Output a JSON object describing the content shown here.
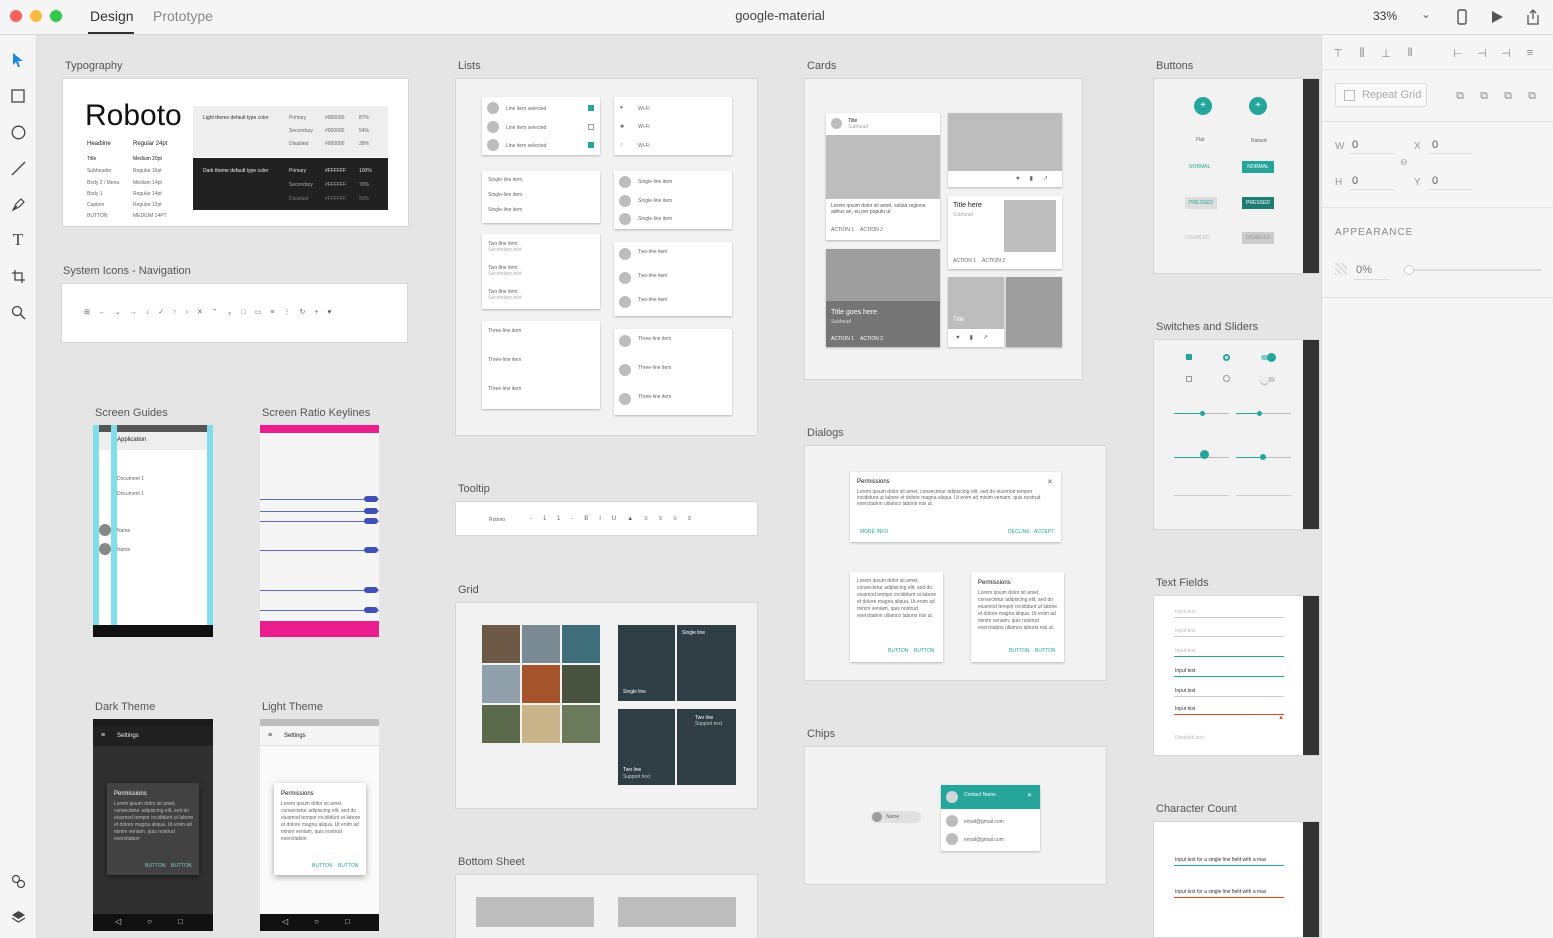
{
  "titlebar": {
    "tabs": [
      "Design",
      "Prototype"
    ],
    "doc_title": "google-material",
    "zoom": "33%"
  },
  "tools": [
    "select-tool",
    "rectangle-tool",
    "ellipse-tool",
    "line-tool",
    "pen-tool",
    "text-tool",
    "artboard-tool",
    "zoom-tool"
  ],
  "artboards": {
    "typography": "Typography",
    "system_icons": "System Icons - Navigation",
    "screen_guides": "Screen Guides",
    "screen_ratio": "Screen Ratio Keylines",
    "dark_theme": "Dark Theme",
    "light_theme": "Light Theme",
    "lists": "Lists",
    "tooltip": "Tooltip",
    "grid": "Grid",
    "bottom_sheet": "Bottom Sheet",
    "cards": "Cards",
    "dialogs": "Dialogs",
    "chips": "Chips",
    "buttons": "Buttons",
    "switches": "Switches and Sliders",
    "text_fields": "Text Fields",
    "character_count": "Character Count"
  },
  "typography": {
    "roboto": "Roboto",
    "rows": [
      [
        "Headline",
        "Regular 24pt"
      ],
      [
        "Title",
        "Medium 20pt"
      ],
      [
        "Subheader",
        "Regular 16pt"
      ],
      [
        "Body 2 / Menu",
        "Medium 14pt"
      ],
      [
        "Body 1",
        "Regular 14pt"
      ],
      [
        "Caption",
        "Regular 12pt"
      ],
      [
        "BUTTON",
        "MEDIUM 14PT"
      ]
    ],
    "light_label": "Light theme default type color",
    "dark_label": "Dark theme default type color",
    "light_rows": [
      [
        "Primary",
        "#000000",
        "87%"
      ],
      [
        "Secondary",
        "#000000",
        "54%"
      ],
      [
        "Disabled",
        "#000000",
        "38%"
      ]
    ],
    "dark_rows": [
      [
        "Primary",
        "#FFFFFF",
        "100%"
      ],
      [
        "Secondary",
        "#FFFFFF",
        "70%"
      ],
      [
        "Disabled",
        "#FFFFFF",
        "50%"
      ]
    ]
  },
  "guides": {
    "app_title": "Application",
    "items": [
      "Document 1",
      "Document 1",
      "Name",
      "Name"
    ]
  },
  "dark_theme": {
    "bar": "Settings",
    "dialog_title": "Permissions",
    "dialog_text": "Lorem ipsum dolor sit amet, consectetur adipiscing elit, sed do eiusmod tempor incididunt ut labore et dolore magna aliqua. Ut enim ad minim veniam, quis nostrud exercitation",
    "btn1": "BUTTON",
    "btn2": "BUTTON"
  },
  "light_theme": {
    "bar": "Settings",
    "dialog_title": "Permissions",
    "dialog_text": "Lorem ipsum dolor sit amet, consectetur adipiscing elit, sed do eiusmod tempor incididunt ut labore et dolore magna aliqua. Ut enim ad minim veniam, quis nostrud exercitation",
    "btn1": "BUTTON",
    "btn2": "BUTTON"
  },
  "lists": {
    "selected": [
      "Line item selected",
      "Line item selected",
      "Line item selected"
    ],
    "wifi": [
      "Wi-Fi",
      "Wi-Fi",
      "Wi-Fi"
    ],
    "single": [
      "Single-line item",
      "Single-line item",
      "Single-line item"
    ],
    "two": "Two-line item",
    "two_sub": "Secondary text",
    "three": "Three-line item"
  },
  "tooltip": {
    "font": "Roboto"
  },
  "grid": {
    "single": "Single line",
    "two": "Two line",
    "support": "Support text"
  },
  "cards": {
    "title": "Title",
    "subtitle": "Subhead",
    "text": "Lorem ipsum dolor sit amet, soluta regione adhuc an, eu per populo ut",
    "action1": "ACTION 1",
    "action2": "ACTION 2",
    "title_here": "Title here",
    "title_goes_here": "Title goes here",
    "title_small": "Title"
  },
  "dialogs": {
    "title": "Permissions",
    "text": "Lorem ipsum dolor sit amet, consectetur adipiscing elit, sed do eiusmod tempor incididunt ut labore et dolore magna aliqua. Ut enim ad minim veniam, quis nostrud exercitation ullamco laboris nisi ut.",
    "more": "MORE INFO",
    "decline": "DECLINE",
    "accept": "ACCEPT",
    "button": "BUTTON"
  },
  "chips": {
    "chip_label": "Name",
    "contact_name": "Contact Name",
    "emails": [
      "email@gmail.com",
      "email@gmail.com"
    ]
  },
  "buttons": {
    "flat": "Flat",
    "raised": "Raised",
    "normal": "NORMAL",
    "pressed": "PRESSED",
    "disabled": "DISABLED"
  },
  "text_fields": {
    "labels": [
      "Input text",
      "Input text",
      "Input text",
      "Input text",
      "Input text",
      "Input text",
      "Disabled text"
    ]
  },
  "char_count": {
    "input": "Input text for a single line field with a max"
  },
  "panel": {
    "repeat_grid": "Repeat Grid",
    "w_label": "W",
    "w_value": "0",
    "x_label": "X",
    "x_value": "0",
    "h_label": "H",
    "h_value": "0",
    "y_label": "Y",
    "y_value": "0",
    "appearance": "APPEARANCE",
    "opacity": "0%"
  },
  "colors": {
    "accent": "#26a69a",
    "magenta": "#e91e8c",
    "cyan": "#80deea",
    "dark": "#333333"
  }
}
